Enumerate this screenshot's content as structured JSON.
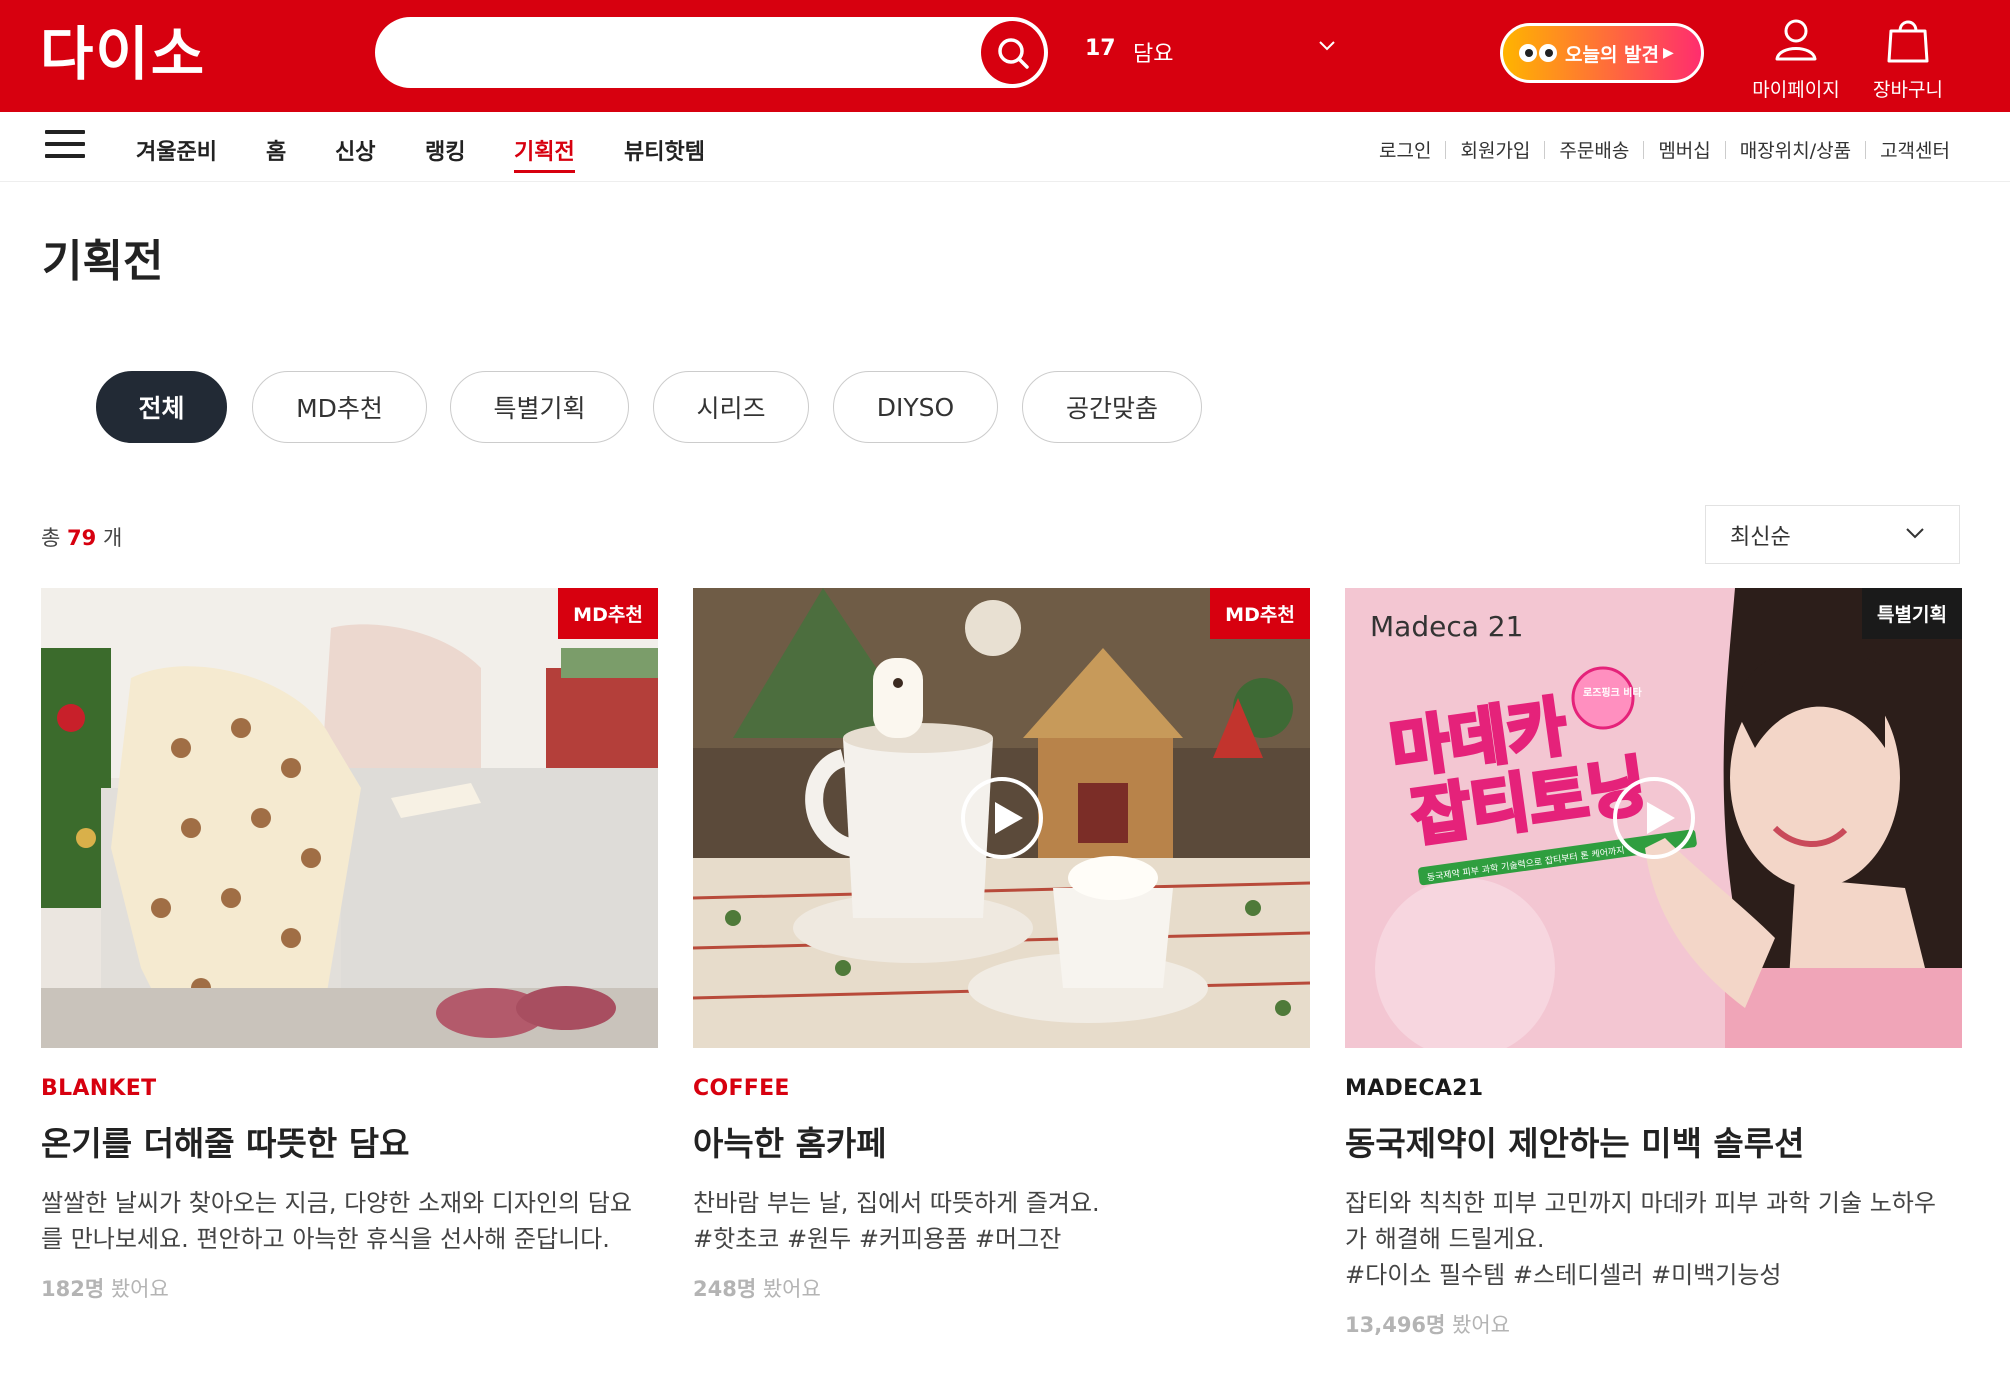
{
  "header": {
    "logo_text": "다이소",
    "search_rank": "17",
    "search_keyword": "담요",
    "discover_label": "오늘의 발견",
    "mypage_label": "마이페이지",
    "cart_label": "장바구니",
    "brand_color": "#d7000f"
  },
  "nav": {
    "items": [
      {
        "label": "겨울준비"
      },
      {
        "label": "홈"
      },
      {
        "label": "신상"
      },
      {
        "label": "랭킹"
      },
      {
        "label": "기획전"
      },
      {
        "label": "뷰티핫템"
      }
    ],
    "active": "기획전",
    "util_links": [
      "로그인",
      "회원가입",
      "주문배송",
      "멤버십",
      "매장위치/상품",
      "고객센터"
    ]
  },
  "page": {
    "title": "기획전",
    "filters": [
      "전체",
      "MD추천",
      "특별기획",
      "시리즈",
      "DIYSO",
      "공간맞춤"
    ],
    "active_filter": "전체",
    "count_prefix": "총",
    "count": "79",
    "count_suffix": "개",
    "sort_label": "최신순"
  },
  "cards": [
    {
      "badge": "MD추천",
      "eyebrow": "BLANKET",
      "title": "온기를 더해줄 따뜻한 담요",
      "desc_lines": [
        "쌀쌀한 날씨가 찾아오는 지금, 다양한 소재와 디자인의 담요",
        "를 만나보세요. 편안하고 아늑한 휴식을 선사해 준답니다."
      ],
      "views": "182명",
      "views_suffix": "봤어요"
    },
    {
      "badge": "MD추천",
      "eyebrow": "COFFEE",
      "title": "아늑한 홈카페",
      "desc_lines": [
        "찬바람 부는 날, 집에서 따뜻하게 즐겨요.",
        "#핫초코 #원두 #커피용품 #머그잔"
      ],
      "views": "248명",
      "views_suffix": "봤어요"
    },
    {
      "badge": "특별기획",
      "eyebrow": "MADECA21",
      "title": "동국제약이 제안하는 미백 솔루션",
      "desc_lines": [
        "잡티와 칙칙한 피부 고민까지 마데카 피부 과학 기술 노하우",
        "가 해결해 드릴게요.",
        "#다이소 필수템 #스테디셀러 #미백기능성"
      ],
      "views": "13,496명",
      "views_suffix": "봤어요",
      "image_text": {
        "brand": "Madeca 21",
        "headline1": "마데카",
        "headline2": "잡티토닝",
        "sticker": "로즈핑크 비타",
        "tagline": "동국제약 피부 과학 기술력으로 잡티부터 톤 케어까지"
      }
    }
  ]
}
